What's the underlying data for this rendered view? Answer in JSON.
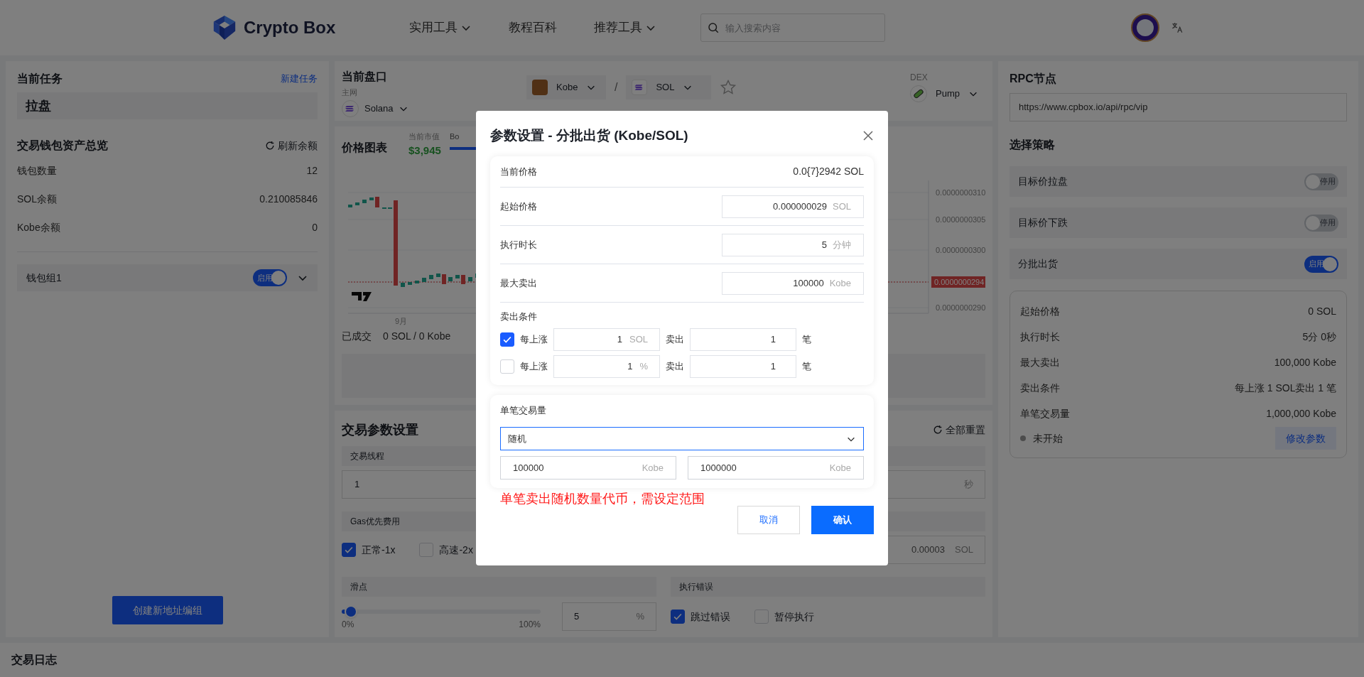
{
  "header": {
    "logo": "Crypto Box",
    "nav": [
      {
        "label": "实用工具",
        "dropdown": true
      },
      {
        "label": "教程百科",
        "dropdown": false
      },
      {
        "label": "推荐工具",
        "dropdown": true
      }
    ],
    "search": {
      "placeholder": "输入搜索内容"
    }
  },
  "current_task": {
    "title": "当前任务",
    "new_link": "新建任务",
    "task": "拉盘"
  },
  "wallet_overview": {
    "title": "交易钱包资产总览",
    "refresh": "刷新余额",
    "rows": [
      {
        "label": "钱包数量",
        "value": "12"
      },
      {
        "label": "SOL余额",
        "value": "0.210085846"
      },
      {
        "label": "Kobe余额",
        "value": "0"
      }
    ],
    "groups": [
      {
        "name": "钱包组1",
        "toggle_label": "启用",
        "on": true
      }
    ],
    "create_button": "创建新地址编组"
  },
  "market": {
    "title": "当前盘口",
    "network_label": "主网",
    "network": "Solana",
    "base": "Kobe",
    "separator": "/",
    "quote": "SOL",
    "favorite": false,
    "dex_label": "DEX",
    "dex": "Pump"
  },
  "price_chart": {
    "title": "价格图表",
    "market_cap_label": "当前市值",
    "market_cap": "$3,945",
    "legend": "Bo",
    "y_labels": [
      "0.0000000310",
      "0.0000000305",
      "0.0000000300",
      "0.0000000290"
    ],
    "current_price_tag": "0.0000000294",
    "x_label": "9月",
    "traded_label": "已成交",
    "traded": "0 SOL / 0 Kobe"
  },
  "trade_params": {
    "title": "交易参数设置",
    "reset": "全部重置",
    "threads": {
      "label": "交易线程",
      "value": "1"
    },
    "interval": {
      "unit": "秒"
    },
    "gas": {
      "label": "Gas优先费用",
      "options": [
        {
          "label": "正常-1x",
          "checked": true
        },
        {
          "label": "高速-2x",
          "checked": false
        }
      ],
      "value": "0.00003",
      "unit": "SOL"
    },
    "slippage": {
      "label": "滑点",
      "level": 0.02,
      "min": "0%",
      "max": "100%",
      "value": "5",
      "unit": "%"
    },
    "errors": {
      "label": "执行错误",
      "options": [
        {
          "label": "跳过错误",
          "checked": true
        },
        {
          "label": "暂停执行",
          "checked": false
        }
      ]
    }
  },
  "rpc": {
    "title": "RPC节点",
    "url": "https://www.cpbox.io/api/rpc/vip"
  },
  "strategy": {
    "title": "选择策略",
    "items": [
      {
        "label": "目标价拉盘",
        "toggle_label": "停用",
        "on": false
      },
      {
        "label": "目标价下跌",
        "toggle_label": "停用",
        "on": false
      },
      {
        "label": "分批出货",
        "toggle_label": "启用",
        "on": true
      }
    ],
    "summary": {
      "rows": [
        {
          "label": "起始价格",
          "value": "0 SOL"
        },
        {
          "label": "执行时长",
          "value": "5分 0秒"
        },
        {
          "label": "最大卖出",
          "value": "100,000 Kobe"
        },
        {
          "label": "卖出条件",
          "value": "每上涨 1 SOL卖出 1 笔"
        },
        {
          "label": "单笔交易量",
          "value": "1,000,000 Kobe"
        }
      ],
      "status": "未开始",
      "edit_button": "修改参数"
    }
  },
  "log": {
    "title": "交易日志"
  },
  "dialog": {
    "title": "参数设置 - 分批出货 (Kobe/SOL)",
    "current_price": {
      "label": "当前价格",
      "value": "0.0{7}2942 SOL"
    },
    "fields": [
      {
        "label": "起始价格",
        "value": "0.000000029",
        "unit": "SOL"
      },
      {
        "label": "执行时长",
        "value": "5",
        "unit": "分钟"
      },
      {
        "label": "最大卖出",
        "value": "100000",
        "unit": "Kobe"
      }
    ],
    "conditions": {
      "label": "卖出条件",
      "rows": [
        {
          "checked": true,
          "rise_label": "每上涨",
          "value": "1",
          "unit": "SOL",
          "sell_label": "卖出",
          "count": "1",
          "count_unit": "笔"
        },
        {
          "checked": false,
          "rise_label": "每上涨",
          "value": "1",
          "unit": "%",
          "sell_label": "卖出",
          "count": "1",
          "count_unit": "笔"
        }
      ]
    },
    "amount": {
      "label": "单笔交易量",
      "mode": "随机",
      "min": {
        "value": "100000",
        "unit": "Kobe"
      },
      "max": {
        "value": "1000000",
        "unit": "Kobe"
      }
    },
    "hint": "单笔卖出随机数量代币，需设定范围",
    "cancel": "取消",
    "confirm": "确认"
  }
}
